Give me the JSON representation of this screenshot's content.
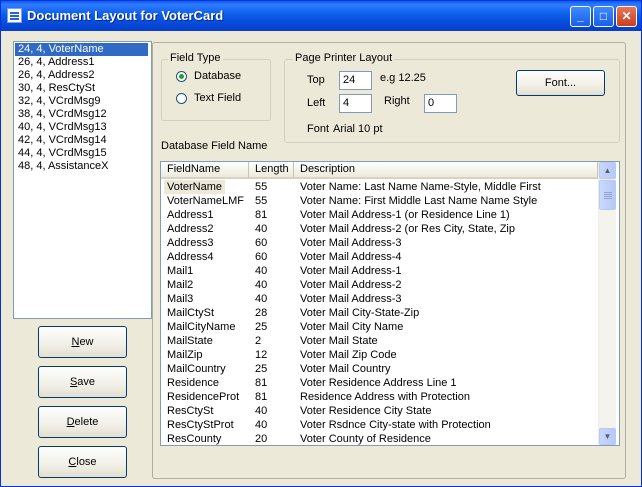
{
  "window": {
    "title": "Document Layout for VoterCard"
  },
  "titlebar_buttons": {
    "minimize": "_",
    "maximize": "□",
    "close": "✕"
  },
  "layout_list": {
    "items": [
      "24, 4, VoterName",
      "26, 4, Address1",
      "26, 4, Address2",
      "30, 4, ResCtySt",
      "32, 4, VCrdMsg9",
      "38, 4, VCrdMsg12",
      "40, 4, VCrdMsg13",
      "42, 4, VCrdMsg14",
      "44, 4, VCrdMsg15",
      "48, 4, AssistanceX"
    ],
    "selected_index": 0
  },
  "buttons": {
    "new_first": "N",
    "new_rest": "ew",
    "save_first": "S",
    "save_rest": "ave",
    "delete_first": "D",
    "delete_rest": "elete",
    "close_first": "C",
    "close_rest": "lose"
  },
  "field_type": {
    "title": "Field Type",
    "options": [
      "Database",
      "Text Field"
    ],
    "selected": "Database"
  },
  "page_printer_layout": {
    "title": "Page Printer Layout",
    "top_label": "Top",
    "top_value": "24",
    "example": "e.g 12.25",
    "left_label": "Left",
    "left_value": "4",
    "right_label": "Right",
    "right_value": "0",
    "font_button": "Font...",
    "font_label": "Font",
    "font_value": "Arial 10 pt"
  },
  "database_field": {
    "label": "Database Field Name",
    "columns": [
      "FieldName",
      "Length",
      "Description"
    ],
    "rows": [
      [
        "VoterName",
        "55",
        "Voter Name: Last Name Name-Style, Middle First"
      ],
      [
        "VoterNameLMF",
        "55",
        "Voter Name: First Middle Last Name Name Style"
      ],
      [
        "Address1",
        "81",
        "Voter Mail Address-1 (or Residence Line 1)"
      ],
      [
        "Address2",
        "40",
        "Voter Mail Address-2 (or Res City, State, Zip"
      ],
      [
        "Address3",
        "60",
        "Voter Mail Address-3"
      ],
      [
        "Address4",
        "60",
        "Voter Mail Address-4"
      ],
      [
        "Mail1",
        "40",
        "Voter Mail Address-1"
      ],
      [
        "Mail2",
        "40",
        "Voter Mail Address-2"
      ],
      [
        "Mail3",
        "40",
        "Voter Mail Address-3"
      ],
      [
        "MailCtySt",
        "28",
        "Voter Mail City-State-Zip"
      ],
      [
        "MailCityName",
        "25",
        "Voter Mail City Name"
      ],
      [
        "MailState",
        "2",
        "Voter Mail State"
      ],
      [
        "MailZip",
        "12",
        "Voter Mail Zip Code"
      ],
      [
        "MailCountry",
        "25",
        "Voter Mail Country"
      ],
      [
        "Residence",
        "81",
        "Voter Residence Address Line 1"
      ],
      [
        "ResidenceProt",
        "81",
        "Residence Address with Protection"
      ],
      [
        "ResCtySt",
        "40",
        "Voter Residence City State"
      ],
      [
        "ResCtyStProt",
        "40",
        "Voter Rsdnce City-state with Protection"
      ],
      [
        "ResCounty",
        "20",
        "Voter County of Residence"
      ]
    ],
    "selected_index": 0,
    "scroll_up": "▲",
    "scroll_down": "▼"
  }
}
